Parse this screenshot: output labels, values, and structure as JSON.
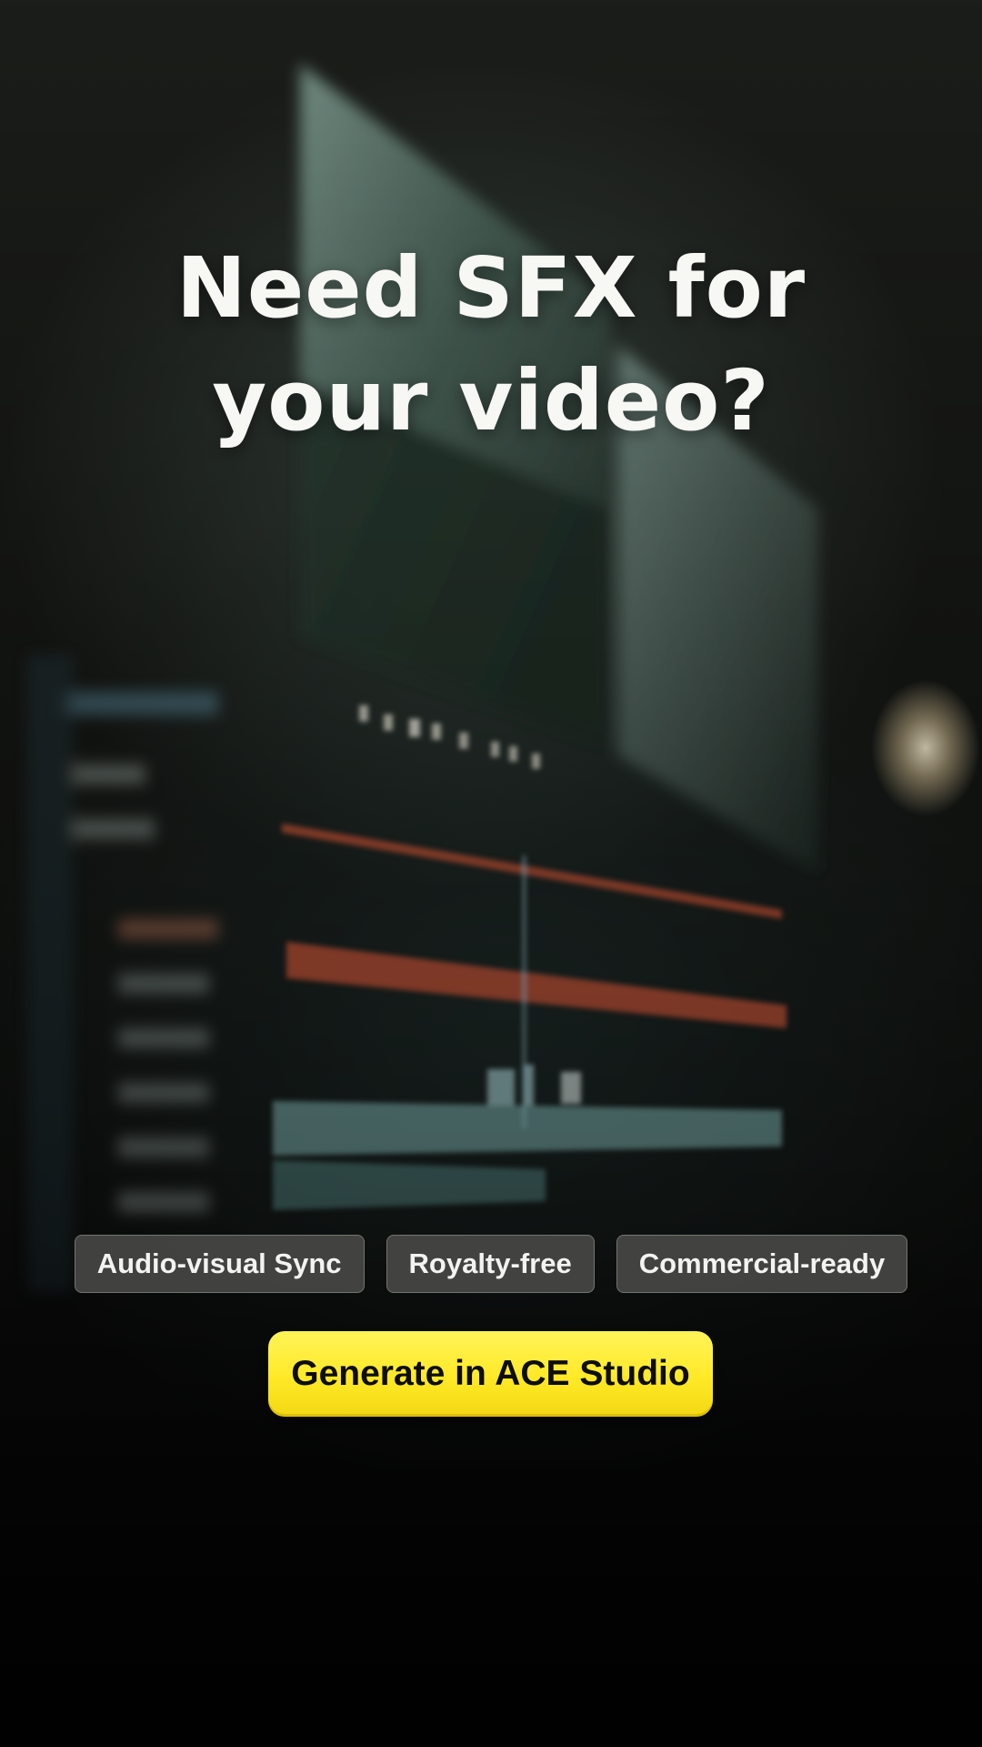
{
  "headline": {
    "line1": "Need SFX for",
    "line2": "your video?"
  },
  "features": [
    "Audio-visual Sync",
    "Royalty-free",
    "Commercial-ready"
  ],
  "cta": {
    "label": "Generate in ACE Studio"
  },
  "colors": {
    "cta_background": "#ffe926",
    "cta_text": "#0d0d0d",
    "pill_background": "#4e4e4c",
    "headline_text": "#f7f7f3",
    "timeline_orange": "#c8553a",
    "timeline_teal": "#7fb3b0"
  }
}
